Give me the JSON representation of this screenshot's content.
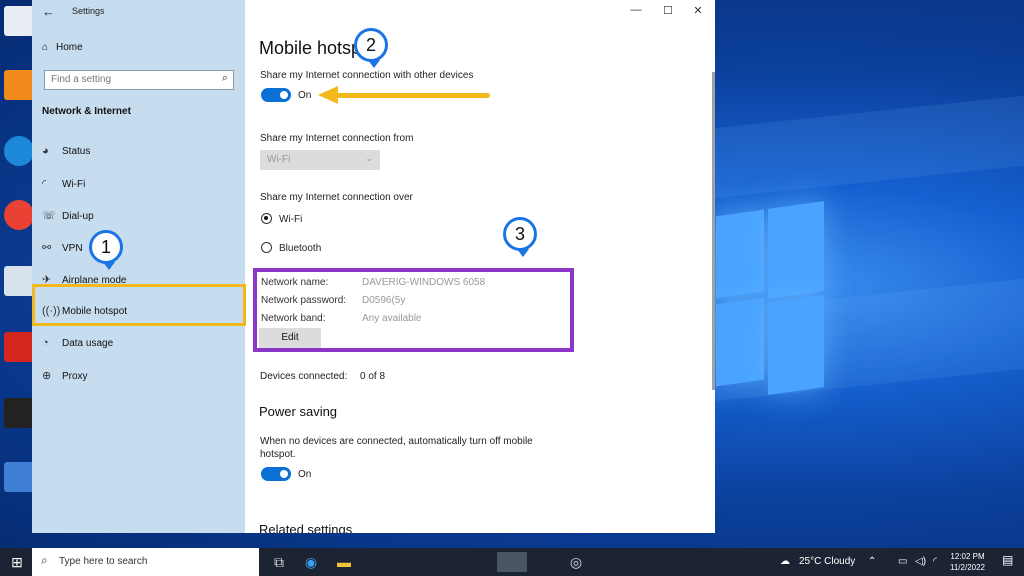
{
  "window": {
    "title": "Settings",
    "back_icon": "back-arrow-icon",
    "minimize": "—",
    "maximize": "☐",
    "close": "✕"
  },
  "sidebar": {
    "home": "Home",
    "search_placeholder": "Find a setting",
    "section_title": "Network & Internet",
    "items": [
      {
        "label": "Status",
        "icon": "status-icon"
      },
      {
        "label": "Wi-Fi",
        "icon": "wifi-icon"
      },
      {
        "label": "Dial-up",
        "icon": "dialup-icon"
      },
      {
        "label": "VPN",
        "icon": "vpn-icon"
      },
      {
        "label": "Airplane mode",
        "icon": "airplane-icon"
      },
      {
        "label": "Mobile hotspot",
        "icon": "hotspot-icon"
      },
      {
        "label": "Data usage",
        "icon": "data-usage-icon"
      },
      {
        "label": "Proxy",
        "icon": "proxy-icon"
      }
    ],
    "selected": "Mobile hotspot"
  },
  "main": {
    "title": "Mobile hotspot",
    "share_with_label": "Share my Internet connection with other devices",
    "share_toggle_state": "On",
    "share_from_label": "Share my Internet connection from",
    "share_from_value": "Wi-Fi",
    "share_over_label": "Share my Internet connection over",
    "share_over_options": [
      "Wi-Fi",
      "Bluetooth"
    ],
    "share_over_selected": "Wi-Fi",
    "network_name_label": "Network name:",
    "network_name_value": "DAVERIG-WINDOWS 6058",
    "network_password_label": "Network password:",
    "network_password_value": "D0596(5y",
    "network_band_label": "Network band:",
    "network_band_value": "Any available",
    "edit_button": "Edit",
    "devices_connected_label": "Devices connected:",
    "devices_connected_value": "0 of 8",
    "power_saving_title": "Power saving",
    "power_saving_desc": "When no devices are connected, automatically turn off mobile hotspot.",
    "power_toggle_state": "On",
    "related_settings": "Related settings"
  },
  "annotations": {
    "step1": "1",
    "step2": "2",
    "step3": "3",
    "highlight_color": "#f3b81b",
    "box_color": "#8a37c7",
    "pin_color": "#1a74e8"
  },
  "taskbar": {
    "search_placeholder": "Type here to search",
    "weather": "25°C  Cloudy",
    "time": "12:02 PM",
    "date": "11/2/2022"
  }
}
